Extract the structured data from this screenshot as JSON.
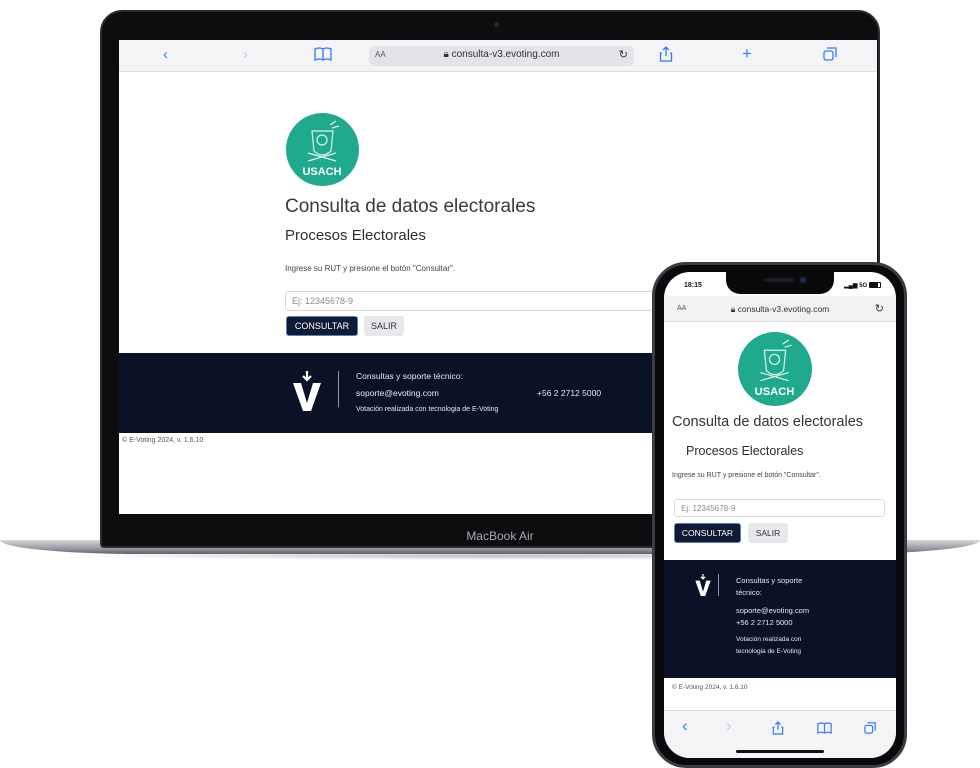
{
  "laptop": {
    "model_label": "MacBook Air",
    "browser": {
      "reader_label": "AA",
      "url": "consulta-v3.evoting.com",
      "back_icon": "chevron-left-icon",
      "forward_icon": "chevron-right-icon",
      "bookmarks_icon": "book-icon",
      "reload_icon": "reload-icon",
      "share_icon": "share-icon",
      "new_tab_icon": "plus-icon",
      "tabs_icon": "tabs-icon"
    }
  },
  "phone": {
    "status": {
      "time": "18:15",
      "signal": "5G"
    },
    "browser": {
      "reader_label": "AA",
      "url": "consulta-v3.evoting.com"
    }
  },
  "page": {
    "logo_text": "USACH",
    "title": "Consulta de datos electorales",
    "subtitle": "Procesos Electorales",
    "instruction": "Ingrese su RUT y presione el botón \"Consultar\".",
    "rut_placeholder": "Ej: 12345678-9",
    "consult_button": "CONSULTAR",
    "exit_button": "SALIR",
    "footer": {
      "support_label": "Consultas y soporte técnico:",
      "support_label_line1": "Consultas y soporte",
      "support_label_line2": "técnico:",
      "email": "soporte@evoting.com",
      "phone": "+56 2 2712 5000",
      "tech_note": "Votación realizada con tecnologia de E-Voting",
      "tech_note_line1": "Votación realizada con",
      "tech_note_line2": "tecnologia de E-Voting"
    },
    "copyright": "© E-Voting 2024, v. 1.6.10"
  },
  "colors": {
    "logo_teal": "#1fa98d",
    "footer_navy": "#0b1228",
    "primary_button": "#0f1a35",
    "ios_blue": "#2f7cf6"
  }
}
